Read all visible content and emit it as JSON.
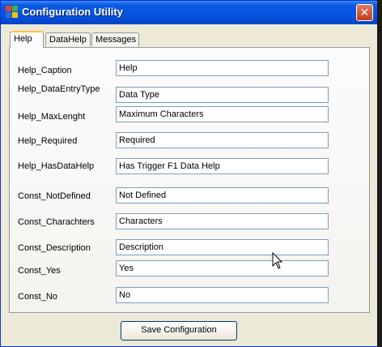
{
  "window": {
    "title": "Configuration Utility",
    "close_glyph": "✕"
  },
  "tabs": [
    {
      "label": "Help",
      "active": true
    },
    {
      "label": "DataHelp",
      "active": false
    },
    {
      "label": "Messages",
      "active": false
    }
  ],
  "fields": [
    {
      "label": "Help_Caption",
      "value": "Help"
    },
    {
      "label": "Help_DataEntryType",
      "value": "Data Type"
    },
    {
      "label": "Help_MaxLenght",
      "value": "Maximum Characters"
    },
    {
      "label": "Help_Required",
      "value": "Required"
    },
    {
      "label": "Help_HasDataHelp",
      "value": "Has Trigger F1 Data Help"
    },
    {
      "label": "Const_NotDefined",
      "value": "Not Defined"
    },
    {
      "label": "Const_Charachters",
      "value": "Characters"
    },
    {
      "label": "Const_Description",
      "value": "Description"
    },
    {
      "label": "Const_Yes",
      "value": "Yes"
    },
    {
      "label": "Const_No",
      "value": "No"
    }
  ],
  "save_button": {
    "label": "Save Configuration"
  },
  "icons": {
    "app": "windows-app-icon",
    "close": "close-icon",
    "cursor": "mouse-pointer-icon"
  },
  "colors": {
    "titlebar": "#0553e0",
    "close_button": "#c13d15",
    "active_tab_accent": "#ffc73c",
    "window_bg": "#ece9d8"
  }
}
